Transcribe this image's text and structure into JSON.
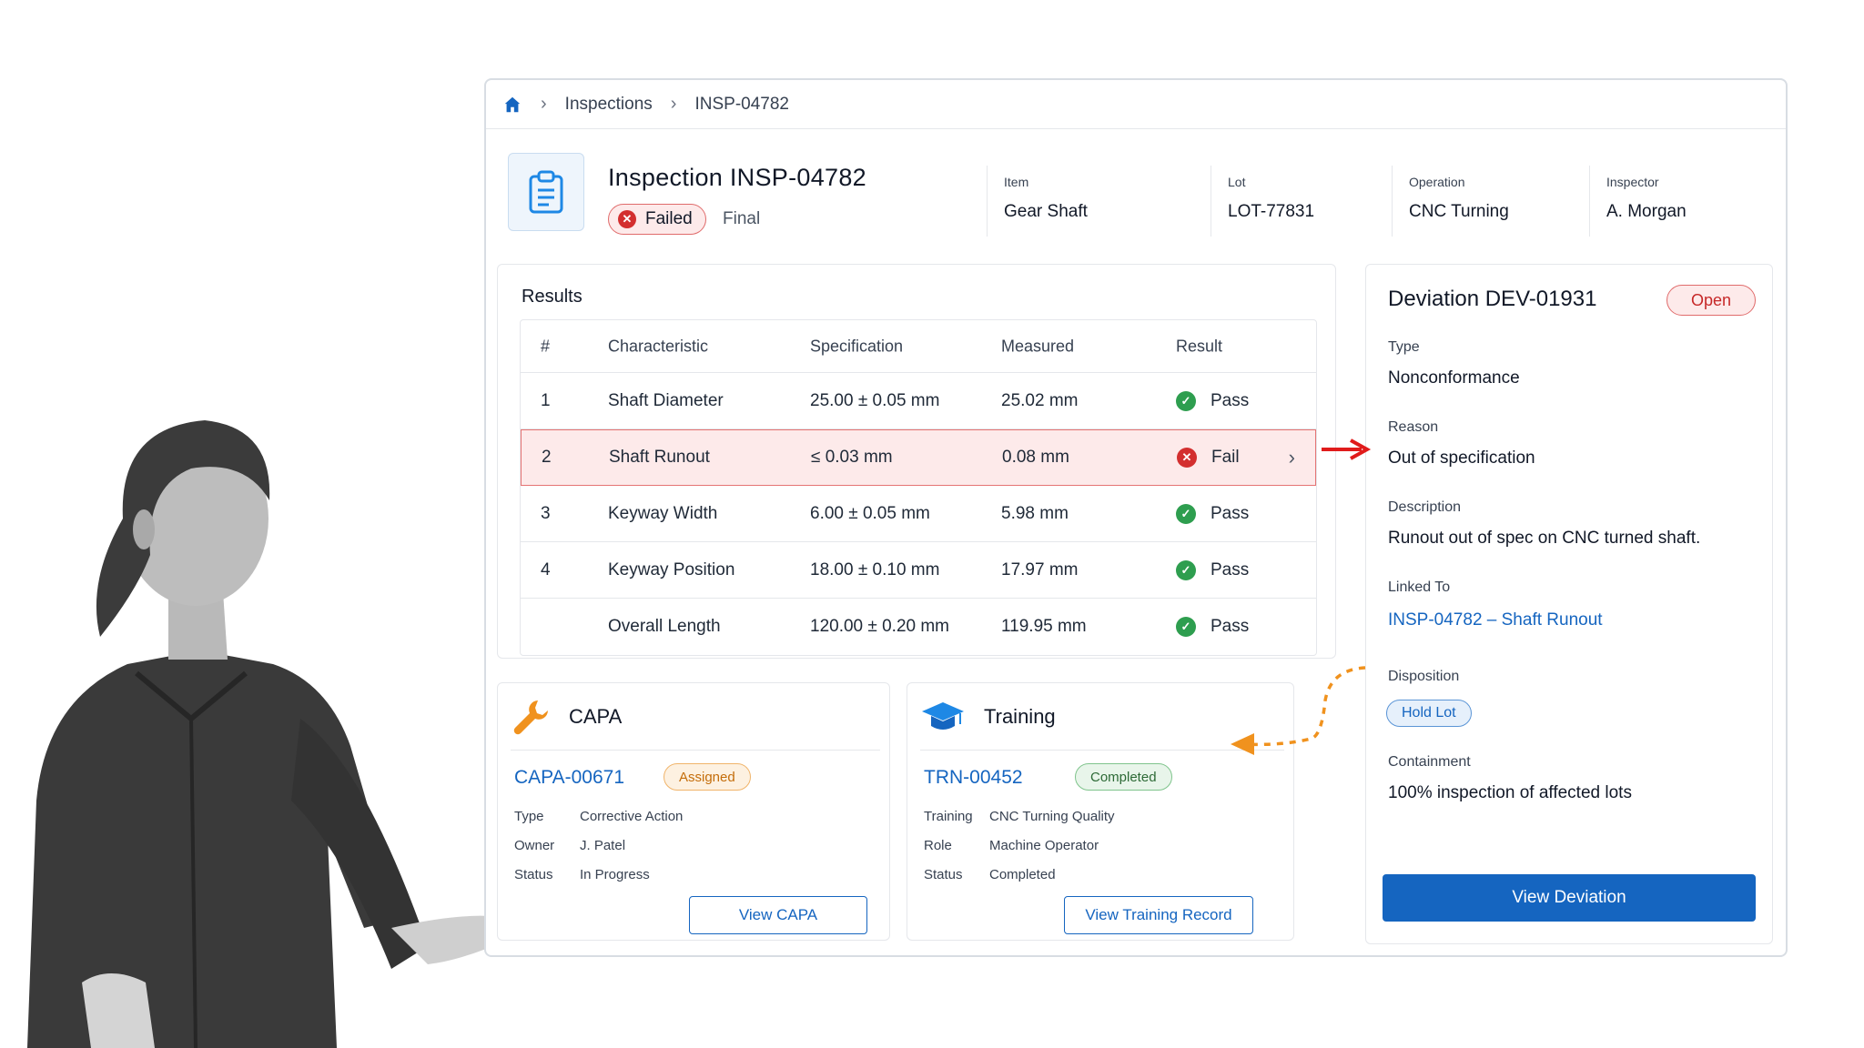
{
  "breadcrumb": {
    "items": [
      "Inspections",
      "INSP-04782"
    ]
  },
  "inspection": {
    "title": "Inspection INSP-04782",
    "status": "Failed",
    "stage": "Final",
    "meta": [
      {
        "label": "Item",
        "value": "Gear Shaft"
      },
      {
        "label": "Lot",
        "value": "LOT-77831"
      },
      {
        "label": "Operation",
        "value": "CNC Turning"
      },
      {
        "label": "Inspector",
        "value": "A. Morgan"
      }
    ]
  },
  "results": {
    "heading": "Results",
    "columns": [
      "#",
      "Characteristic",
      "Specification",
      "Measured",
      "Result"
    ],
    "rows": [
      {
        "num": "1",
        "characteristic": "Shaft Diameter",
        "spec": "25.00 ± 0.05 mm",
        "measured": "25.02 mm",
        "result": "Pass"
      },
      {
        "num": "2",
        "characteristic": "Shaft Runout",
        "spec": "≤ 0.03 mm",
        "measured": "0.08 mm",
        "result": "Fail"
      },
      {
        "num": "3",
        "characteristic": "Keyway Width",
        "spec": "6.00 ± 0.05 mm",
        "measured": "5.98 mm",
        "result": "Pass"
      },
      {
        "num": "4",
        "characteristic": "Keyway Position",
        "spec": "18.00 ± 0.10 mm",
        "measured": "17.97 mm",
        "result": "Pass"
      },
      {
        "num": "",
        "characteristic": "Overall Length",
        "spec": "120.00 ± 0.20 mm",
        "measured": "119.95 mm",
        "result": "Pass"
      }
    ]
  },
  "capa": {
    "title": "CAPA",
    "id": "CAPA-00671",
    "badge": "Assigned",
    "fields": [
      {
        "k": "Type",
        "v": "Corrective Action"
      },
      {
        "k": "Owner",
        "v": "J. Patel"
      },
      {
        "k": "Status",
        "v": "In Progress"
      }
    ],
    "button": "View CAPA"
  },
  "training": {
    "title": "Training",
    "id": "TRN-00452",
    "badge": "Completed",
    "fields": [
      {
        "k": "Training",
        "v": "CNC Turning Quality"
      },
      {
        "k": "Role",
        "v": "Machine Operator"
      },
      {
        "k": "Status",
        "v": "Completed"
      }
    ],
    "button": "View Training Record"
  },
  "deviation": {
    "title": "Deviation DEV-01931",
    "status": "Open",
    "type_label": "Type",
    "type_value": "Nonconformance",
    "reason_label": "Reason",
    "reason_value": "Out of specification",
    "description_label": "Description",
    "description_value": "Runout out of spec on CNC turned shaft.",
    "linked_label": "Linked To",
    "linked_value": "INSP-04782 – Shaft Runout",
    "disposition_label": "Disposition",
    "disposition_value": "Hold Lot",
    "containment_label": "Containment",
    "containment_value": "100% inspection of affected lots",
    "button": "View Deviation"
  },
  "colors": {
    "accent": "#1565c0",
    "fail": "#d32f2f",
    "pass": "#2e9e4f",
    "warning": "#f0921e",
    "arrow_red": "#e01b1b"
  }
}
